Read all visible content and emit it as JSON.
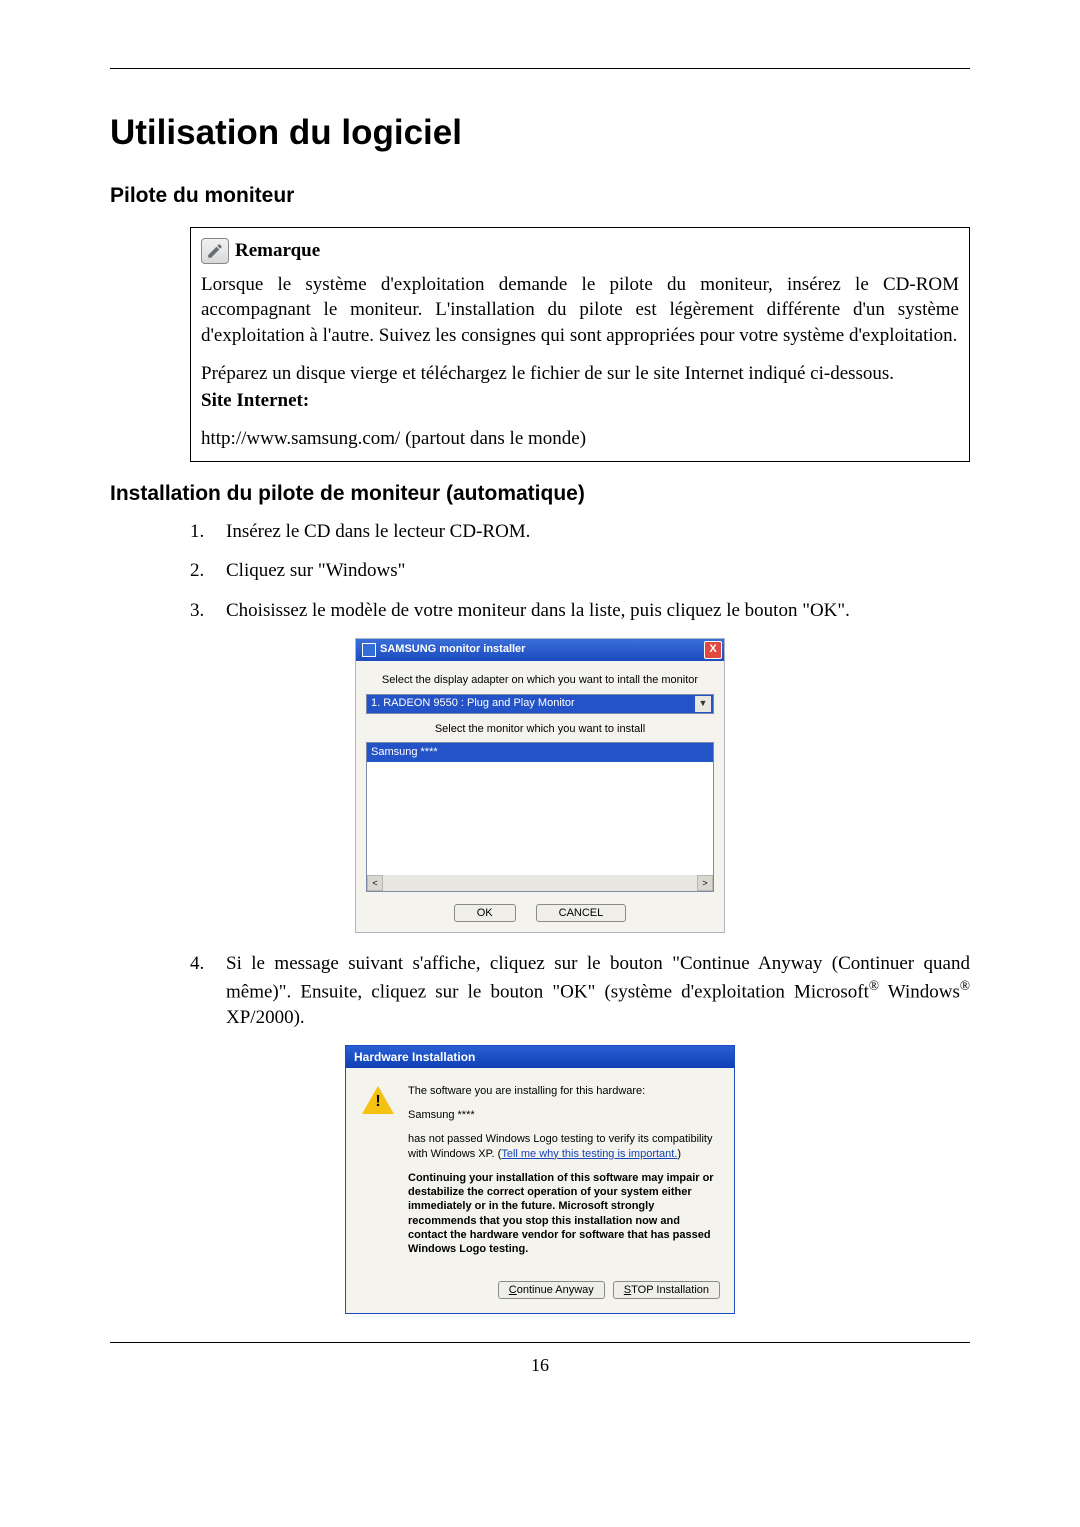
{
  "h1": "Utilisation du logiciel",
  "h2_a": "Pilote du moniteur",
  "note": {
    "title": "Remarque",
    "p1": "Lorsque le système d'exploitation demande le pilote du moniteur, insérez le CD-ROM accompagnant le moniteur. L'installation du pilote est légèrement différente d'un système d'exploitation à l'autre. Suivez les consignes qui sont appropriées pour votre système d'exploitation.",
    "p2": "Préparez un disque vierge et téléchargez le fichier de sur le site Internet indiqué ci-dessous.",
    "site_label": "Site Internet:",
    "url": "http://www.samsung.com/ (partout dans le monde)"
  },
  "h2_b": "Installation du pilote de moniteur (automatique)",
  "steps": {
    "s1": "Insérez le CD dans le lecteur CD-ROM.",
    "s2": "Cliquez sur \"Windows\"",
    "s3": "Choisissez le modèle de votre moniteur dans la liste, puis cliquez le bouton \"OK\".",
    "s4a": "Si le message suivant s'affiche, cliquez sur le bouton \"Continue Anyway (Continuer quand même)\". Ensuite, cliquez sur le bouton \"OK\" (système d'exploitation Microsoft",
    "s4b": " Windows",
    "s4c": " XP/2000)."
  },
  "dlg1": {
    "title": "SAMSUNG monitor installer",
    "close": "X",
    "label1": "Select the display adapter on which you want to intall the monitor",
    "combo": "1. RADEON 9550 : Plug and Play Monitor",
    "label2": "Select the monitor which you want to install",
    "list_item": "Samsung ****",
    "ok": "OK",
    "cancel": "CANCEL"
  },
  "dlg2": {
    "title": "Hardware Installation",
    "p1": "The software you are installing for this hardware:",
    "p2": "Samsung ****",
    "p3a": "has not passed Windows Logo testing to verify its compatibility with Windows XP. (",
    "p3link": "Tell me why this testing is important.",
    "p3b": ")",
    "p4": "Continuing your installation of this software may impair or destabilize the correct operation of your system either immediately or in the future. Microsoft strongly recommends that you stop this installation now and contact the hardware vendor for software that has passed Windows Logo testing.",
    "btn_cont_prefix": "C",
    "btn_cont_rest": "ontinue Anyway",
    "btn_stop_prefix": "S",
    "btn_stop_rest": "TOP Installation"
  },
  "page_num": "16"
}
